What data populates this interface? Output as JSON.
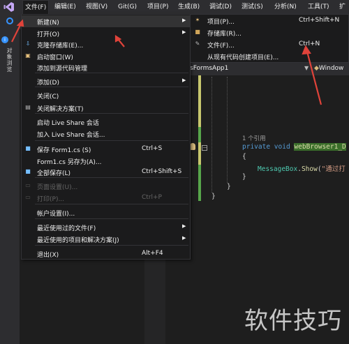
{
  "menubar": {
    "items": [
      {
        "label": "文件(F)"
      },
      {
        "label": "编辑(E)"
      },
      {
        "label": "视图(V)"
      },
      {
        "label": "Git(G)"
      },
      {
        "label": "项目(P)"
      },
      {
        "label": "生成(B)"
      },
      {
        "label": "调试(D)"
      },
      {
        "label": "测试(S)"
      },
      {
        "label": "分析(N)"
      },
      {
        "label": "工具(T)"
      },
      {
        "label": "扩"
      }
    ]
  },
  "side_panel": {
    "tab_label": "对象浏览",
    "info": "i"
  },
  "file_menu": {
    "items": [
      {
        "label": "新建(N)",
        "shortcut": "",
        "icon": "",
        "submenu": true,
        "disabled": false,
        "highlighted": true
      },
      {
        "label": "打开(O)",
        "shortcut": "",
        "icon": "",
        "submenu": true,
        "disabled": false
      },
      {
        "label": "克隆存储库(E)...",
        "shortcut": "",
        "icon": "clone-icon",
        "submenu": false,
        "disabled": false
      },
      {
        "label": "启动窗口(W)",
        "shortcut": "",
        "icon": "start-window-icon",
        "submenu": false,
        "disabled": false
      },
      {
        "label": "添加到源代码管理",
        "shortcut": "",
        "icon": "",
        "submenu": false,
        "disabled": false
      },
      {
        "label": "添加(D)",
        "shortcut": "",
        "icon": "",
        "submenu": true,
        "disabled": false
      },
      {
        "label": "关闭(C)",
        "shortcut": "",
        "icon": "",
        "submenu": false,
        "disabled": false
      },
      {
        "label": "关闭解决方案(T)",
        "shortcut": "",
        "icon": "close-solution-icon",
        "submenu": false,
        "disabled": false
      },
      {
        "label": "启动 Live Share 会话",
        "shortcut": "",
        "icon": "",
        "submenu": false,
        "disabled": false
      },
      {
        "label": "加入 Live Share 会话...",
        "shortcut": "",
        "icon": "",
        "submenu": false,
        "disabled": false
      },
      {
        "label": "保存 Form1.cs (S)",
        "shortcut": "Ctrl+S",
        "icon": "save-icon",
        "submenu": false,
        "disabled": false
      },
      {
        "label": "Form1.cs 另存为(A)...",
        "shortcut": "",
        "icon": "",
        "submenu": false,
        "disabled": false
      },
      {
        "label": "全部保存(L)",
        "shortcut": "Ctrl+Shift+S",
        "icon": "save-all-icon",
        "submenu": false,
        "disabled": false
      },
      {
        "label": "页面设置(U)...",
        "shortcut": "",
        "icon": "page-setup-icon",
        "submenu": false,
        "disabled": true
      },
      {
        "label": "打印(P)...",
        "shortcut": "Ctrl+P",
        "icon": "print-icon",
        "submenu": false,
        "disabled": true
      },
      {
        "label": "帐户设置(I)...",
        "shortcut": "",
        "icon": "",
        "submenu": false,
        "disabled": false
      },
      {
        "label": "最近使用过的文件(F)",
        "shortcut": "",
        "icon": "",
        "submenu": true,
        "disabled": false
      },
      {
        "label": "最近使用的项目和解决方案(J)",
        "shortcut": "",
        "icon": "",
        "submenu": true,
        "disabled": false
      },
      {
        "label": "退出(X)",
        "shortcut": "Alt+F4",
        "icon": "",
        "submenu": false,
        "disabled": false
      }
    ]
  },
  "new_submenu": {
    "items": [
      {
        "label": "项目(P)...",
        "shortcut": "Ctrl+Shift+N",
        "icon": "new-project-icon"
      },
      {
        "label": "存储库(R)...",
        "shortcut": "",
        "icon": "repository-icon"
      },
      {
        "label": "文件(F)...",
        "shortcut": "Ctrl+N",
        "icon": "new-file-icon"
      },
      {
        "label": "从现有代码创建项目(E)...",
        "shortcut": "",
        "icon": ""
      }
    ]
  },
  "editor": {
    "project_dropdown": "sFormsApp1",
    "class_dropdown": "Window",
    "code": {
      "refs": "1 个引用",
      "sig_private": "private",
      "sig_void": "void",
      "sig_name": "webBrowser1_D",
      "open_brace": "{",
      "call_type": "MessageBox",
      "call_dot": ".",
      "call_method": "Show",
      "call_paren": "(",
      "call_string": "\"通过打",
      "close_brace": "}"
    }
  },
  "watermark": "软件技巧",
  "colors": {
    "annotation_arrow": "#e0433a",
    "menu_bg": "#1b1b1c",
    "accent": "#3794ff"
  }
}
